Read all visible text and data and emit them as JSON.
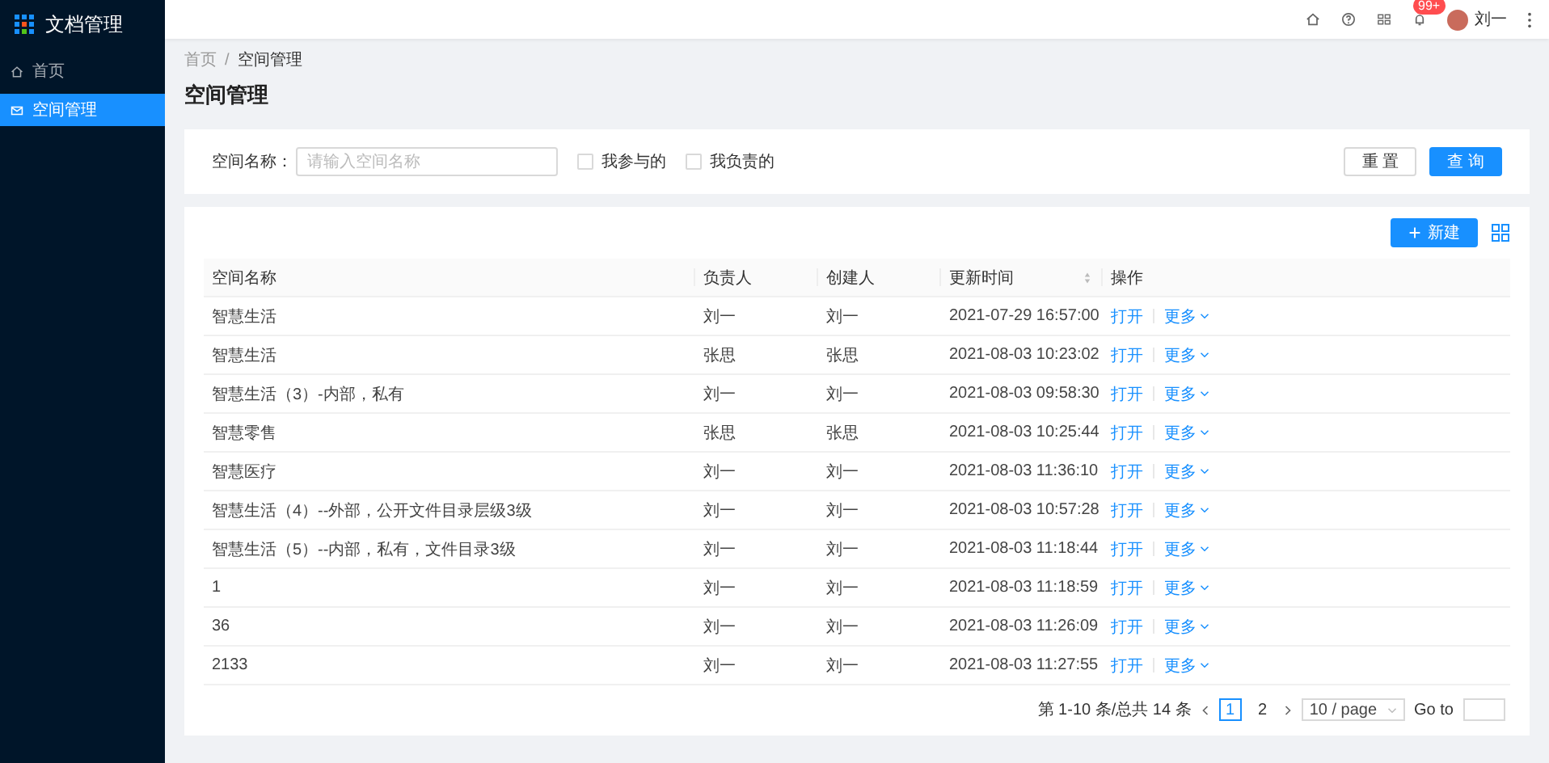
{
  "sidebar": {
    "logo": "文档管理",
    "items": [
      {
        "label": "首页",
        "kind": "home",
        "selected": false
      },
      {
        "label": "空间管理",
        "kind": "space",
        "selected": true
      }
    ]
  },
  "header": {
    "notification_badge": "99+",
    "user": "刘一"
  },
  "breadcrumb": {
    "items": [
      "首页",
      "空间管理"
    ],
    "separator": "/"
  },
  "page_title": "空间管理",
  "filter": {
    "label": "空间名称：",
    "placeholder": "请输入空间名称",
    "checkboxes": [
      {
        "label": "我参与的",
        "checked": false
      },
      {
        "label": "我负责的",
        "checked": false
      }
    ],
    "buttons": [
      {
        "label": "重 置",
        "kind": "default"
      },
      {
        "label": "查 询",
        "kind": "primary"
      }
    ]
  },
  "table": {
    "new_button": "新建",
    "columns": [
      {
        "label": "空间名称",
        "kind": "plain"
      },
      {
        "label": "负责人",
        "kind": "plain"
      },
      {
        "label": "创建人",
        "kind": "plain"
      },
      {
        "label": "更新时间",
        "kind": "sortable"
      },
      {
        "label": "操作",
        "kind": "plain"
      }
    ],
    "rows": [
      {
        "cells": [
          "智慧生活",
          "刘一",
          "刘一",
          "2021-07-29 16:57:00"
        ],
        "actions": [
          "打开",
          "更多"
        ]
      },
      {
        "cells": [
          "智慧生活",
          "张思",
          "张思",
          "2021-08-03 10:23:02"
        ],
        "actions": [
          "打开",
          "更多"
        ]
      },
      {
        "cells": [
          "智慧生活（3）-内部，私有",
          "刘一",
          "刘一",
          "2021-08-03 09:58:30"
        ],
        "actions": [
          "打开",
          "更多"
        ]
      },
      {
        "cells": [
          "智慧零售",
          "张思",
          "张思",
          "2021-08-03 10:25:44"
        ],
        "actions": [
          "打开",
          "更多"
        ]
      },
      {
        "cells": [
          "智慧医疗",
          "刘一",
          "刘一",
          "2021-08-03 11:36:10"
        ],
        "actions": [
          "打开",
          "更多"
        ]
      },
      {
        "cells": [
          "智慧生活（4）--外部，公开文件目录层级3级",
          "刘一",
          "刘一",
          "2021-08-03 10:57:28"
        ],
        "actions": [
          "打开",
          "更多"
        ]
      },
      {
        "cells": [
          "智慧生活（5）--内部，私有，文件目录3级",
          "刘一",
          "刘一",
          "2021-08-03 11:18:44"
        ],
        "actions": [
          "打开",
          "更多"
        ]
      },
      {
        "cells": [
          "1",
          "刘一",
          "刘一",
          "2021-08-03 11:18:59"
        ],
        "actions": [
          "打开",
          "更多"
        ]
      },
      {
        "cells": [
          "36",
          "刘一",
          "刘一",
          "2021-08-03 11:26:09"
        ],
        "actions": [
          "打开",
          "更多"
        ]
      },
      {
        "cells": [
          "2133",
          "刘一",
          "刘一",
          "2021-08-03 11:27:55"
        ],
        "actions": [
          "打开",
          "更多"
        ]
      }
    ]
  },
  "pagination": {
    "summary": "第 1-10 条/总共 14 条",
    "pages": [
      {
        "label": "1",
        "selected": true
      },
      {
        "label": "2",
        "selected": false
      }
    ],
    "page_size": "10 / page",
    "goto_label": "Go to"
  }
}
